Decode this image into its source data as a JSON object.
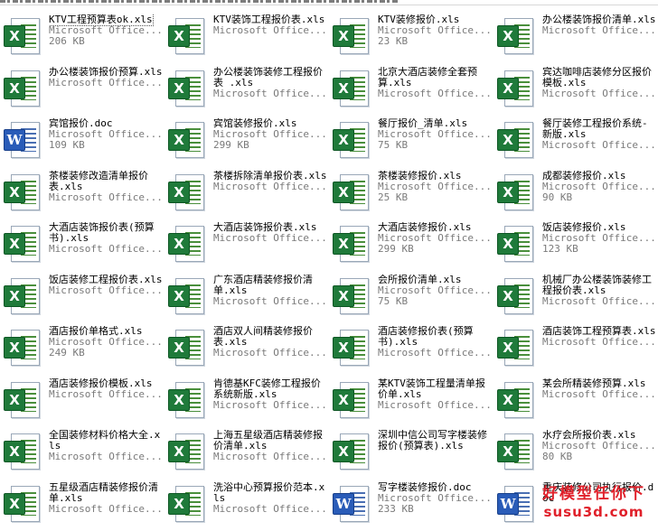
{
  "watermark": {
    "line1": "好模型任你下",
    "line2": "susu3d.com"
  },
  "files": [
    {
      "name": "KTV工程预算表ok.xls",
      "type": "Microsoft Office...",
      "size": "206 KB",
      "icon": "excel-icon",
      "selected": true
    },
    {
      "name": "KTV装饰工程报价表.xls",
      "type": "Microsoft Office...",
      "size": "",
      "icon": "excel-icon"
    },
    {
      "name": "KTV装修报价.xls",
      "type": "Microsoft Office...",
      "size": "23 KB",
      "icon": "excel-icon"
    },
    {
      "name": "办公楼装饰报价清单.xls",
      "type": "Microsoft Office...",
      "size": "",
      "icon": "excel-icon"
    },
    {
      "name": "办公楼装饰报价预算.xls",
      "type": "Microsoft Office...",
      "size": "",
      "icon": "excel-icon"
    },
    {
      "name": "办公楼装饰装修工程报价表 .xls",
      "type": "Microsoft Office...",
      "size": "",
      "icon": "excel-icon"
    },
    {
      "name": "北京大酒店装修全套预算.xls",
      "type": "Microsoft Office...",
      "size": "",
      "icon": "excel-icon"
    },
    {
      "name": "宾达咖啡店装修分区报价模板.xls",
      "type": "Microsoft Office...",
      "size": "",
      "icon": "excel-icon"
    },
    {
      "name": "宾馆报价.doc",
      "type": "Microsoft Office...",
      "size": "109 KB",
      "icon": "word-icon"
    },
    {
      "name": "宾馆装修报价.xls",
      "type": "Microsoft Office...",
      "size": "299 KB",
      "icon": "excel-icon"
    },
    {
      "name": "餐厅报价_清单.xls",
      "type": "Microsoft Office...",
      "size": "75 KB",
      "icon": "excel-icon"
    },
    {
      "name": "餐厅装修工程报价系统-新版.xls",
      "type": "Microsoft Office...",
      "size": "",
      "icon": "excel-icon"
    },
    {
      "name": "茶楼装修改造清单报价表.xls",
      "type": "Microsoft Office...",
      "size": "",
      "icon": "excel-icon"
    },
    {
      "name": "茶楼拆除清单报价表.xls",
      "type": "Microsoft Office...",
      "size": "",
      "icon": "excel-icon"
    },
    {
      "name": "茶楼装修报价.xls",
      "type": "Microsoft Office...",
      "size": "25 KB",
      "icon": "excel-icon"
    },
    {
      "name": "成都装修报价.xls",
      "type": "Microsoft Office...",
      "size": "90 KB",
      "icon": "excel-icon"
    },
    {
      "name": "大酒店装饰报价表(预算书).xls",
      "type": "Microsoft Office...",
      "size": "",
      "icon": "excel-icon"
    },
    {
      "name": "大酒店装饰报价表.xls",
      "type": "Microsoft Office...",
      "size": "",
      "icon": "excel-icon"
    },
    {
      "name": "大酒店装修报价.xls",
      "type": "Microsoft Office...",
      "size": "299 KB",
      "icon": "excel-icon"
    },
    {
      "name": "饭店装修报价.xls",
      "type": "Microsoft Office...",
      "size": "123 KB",
      "icon": "excel-icon"
    },
    {
      "name": "饭店装修工程报价表.xls",
      "type": "Microsoft Office...",
      "size": "",
      "icon": "excel-icon"
    },
    {
      "name": "广东酒店精装修报价清单.xls",
      "type": "Microsoft Office...",
      "size": "",
      "icon": "excel-icon"
    },
    {
      "name": "会所报价清单.xls",
      "type": "Microsoft Office...",
      "size": "75 KB",
      "icon": "excel-icon"
    },
    {
      "name": "机械厂办公楼装饰装修工程报价表.xls",
      "type": "Microsoft Office...",
      "size": "",
      "icon": "excel-icon"
    },
    {
      "name": "酒店报价单格式.xls",
      "type": "Microsoft Office...",
      "size": "249 KB",
      "icon": "excel-icon"
    },
    {
      "name": "酒店双人间精装修报价表.xls",
      "type": "Microsoft Office...",
      "size": "",
      "icon": "excel-icon"
    },
    {
      "name": "酒店装修报价表(预算书).xls",
      "type": "Microsoft Office...",
      "size": "",
      "icon": "excel-icon"
    },
    {
      "name": "酒店装饰工程预算表.xls",
      "type": "Microsoft Office...",
      "size": "",
      "icon": "excel-icon"
    },
    {
      "name": "酒店装修报价模板.xls",
      "type": "Microsoft Office...",
      "size": "",
      "icon": "excel-icon"
    },
    {
      "name": "肯德基KFC装修工程报价系统新版.xls",
      "type": "Microsoft Office...",
      "size": "",
      "icon": "excel-icon"
    },
    {
      "name": "某KTV装饰工程量清单报价单.xls",
      "type": "Microsoft Office...",
      "size": "",
      "icon": "excel-icon"
    },
    {
      "name": "某会所精装修预算.xls",
      "type": "Microsoft Office...",
      "size": "",
      "icon": "excel-icon"
    },
    {
      "name": "全国装修材料价格大全.xls",
      "type": "Microsoft Office...",
      "size": "",
      "icon": "excel-icon"
    },
    {
      "name": "上海五星级酒店精装修报价清单.xls",
      "type": "Microsoft Office...",
      "size": "",
      "icon": "excel-icon"
    },
    {
      "name": "深圳中信公司写字楼装修报价(预算表).xls",
      "type": "",
      "size": "",
      "icon": "excel-icon"
    },
    {
      "name": "水疗会所报价表.xls",
      "type": "Microsoft Office...",
      "size": "80 KB",
      "icon": "excel-icon"
    },
    {
      "name": "五星级酒店精装修报价清单.xls",
      "type": "Microsoft Office...",
      "size": "",
      "icon": "excel-icon"
    },
    {
      "name": "洗浴中心预算报价范本.xls",
      "type": "Microsoft Office...",
      "size": "",
      "icon": "excel-icon"
    },
    {
      "name": "写字楼装修报价.doc",
      "type": "Microsoft Office...",
      "size": "233 KB",
      "icon": "word-icon"
    },
    {
      "name": "重庆装修公司执行报价.doc",
      "type": "",
      "size": "",
      "icon": "word-icon"
    }
  ]
}
